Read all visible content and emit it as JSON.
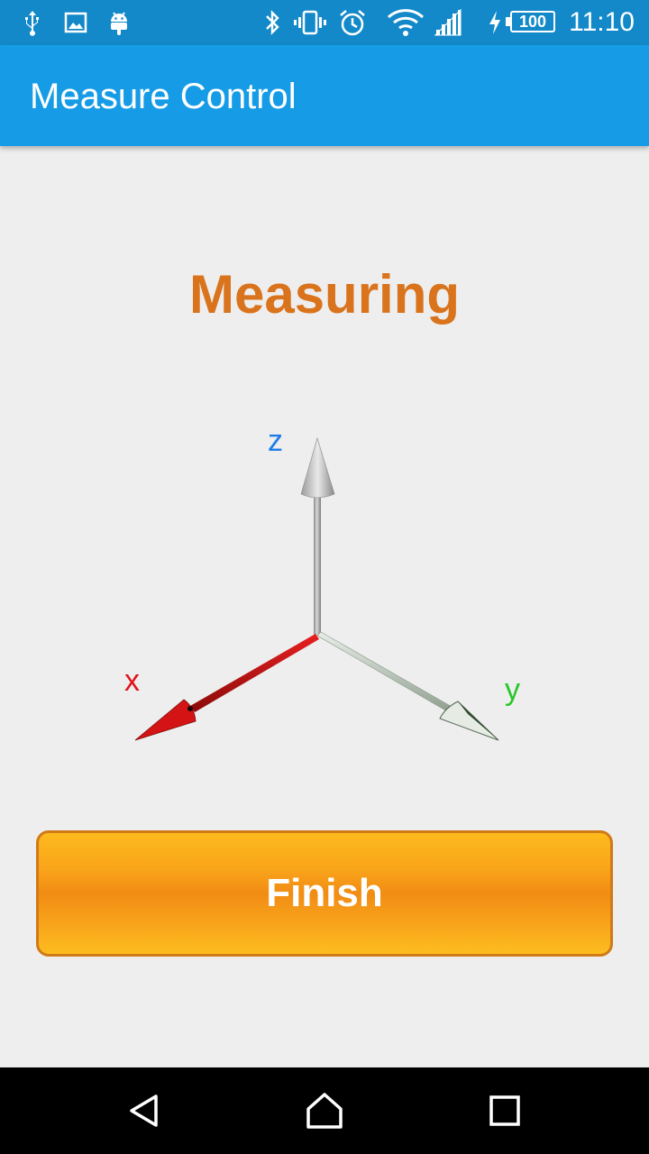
{
  "status_bar": {
    "time": "11:10",
    "battery": "100",
    "icons": [
      "usb-icon",
      "image-icon",
      "android-icon",
      "bluetooth-icon",
      "vibrate-icon",
      "alarm-icon",
      "wifi-icon",
      "signal-icon",
      "charging-icon",
      "battery-icon"
    ]
  },
  "app_bar": {
    "title": "Measure Control",
    "color": "#169ce6"
  },
  "main": {
    "heading": "Measuring",
    "heading_color": "#d9731c",
    "axes": {
      "x_label": "x",
      "y_label": "y",
      "z_label": "z",
      "x_color": "#e0141a",
      "y_color": "#27c72a",
      "z_color": "#1e7ee8"
    },
    "finish_button": {
      "label": "Finish"
    }
  },
  "nav_bar": {
    "buttons": [
      "back-icon",
      "home-icon",
      "recents-icon"
    ]
  }
}
